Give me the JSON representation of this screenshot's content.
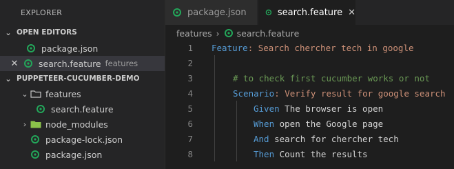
{
  "explorer": {
    "title": "EXPLORER",
    "open_editors": {
      "header": "OPEN EDITORS",
      "items": [
        {
          "label": "package.json",
          "description": ""
        },
        {
          "label": "search.feature",
          "description": "features"
        }
      ]
    },
    "project": {
      "header": "PUPPETEER-CUCUMBER-DEMO",
      "items": [
        {
          "label": "features",
          "type": "folder",
          "expanded": true
        },
        {
          "label": "search.feature",
          "type": "file"
        },
        {
          "label": "node_modules",
          "type": "folder",
          "expanded": false
        },
        {
          "label": "package-lock.json",
          "type": "file"
        },
        {
          "label": "package.json",
          "type": "file"
        }
      ]
    }
  },
  "tabs": [
    {
      "label": "package.json",
      "active": false
    },
    {
      "label": "search.feature",
      "active": true
    }
  ],
  "breadcrumb": {
    "folder": "features",
    "file": "search.feature"
  },
  "editor": {
    "lines": [
      {
        "number": "1",
        "kw": "Feature",
        "rest": ": Search chercher tech in google"
      },
      {
        "number": "2"
      },
      {
        "number": "3",
        "comment": "# to check first cucumber works or not"
      },
      {
        "number": "4",
        "kw": "Scenario",
        "rest": ": Verify result for google search"
      },
      {
        "number": "5",
        "kw": "Given",
        "rest": " The browser is open"
      },
      {
        "number": "6",
        "kw": "When",
        "rest": " open the Google page"
      },
      {
        "number": "7",
        "kw": "And",
        "rest": " search for chercher tech"
      },
      {
        "number": "8",
        "kw": "Then",
        "rest": " Count the results"
      }
    ]
  },
  "colors": {
    "keyword": "#569cd6",
    "string": "#ce9178",
    "comment": "#6a9955",
    "gherkin_icon": "#23a75a"
  }
}
